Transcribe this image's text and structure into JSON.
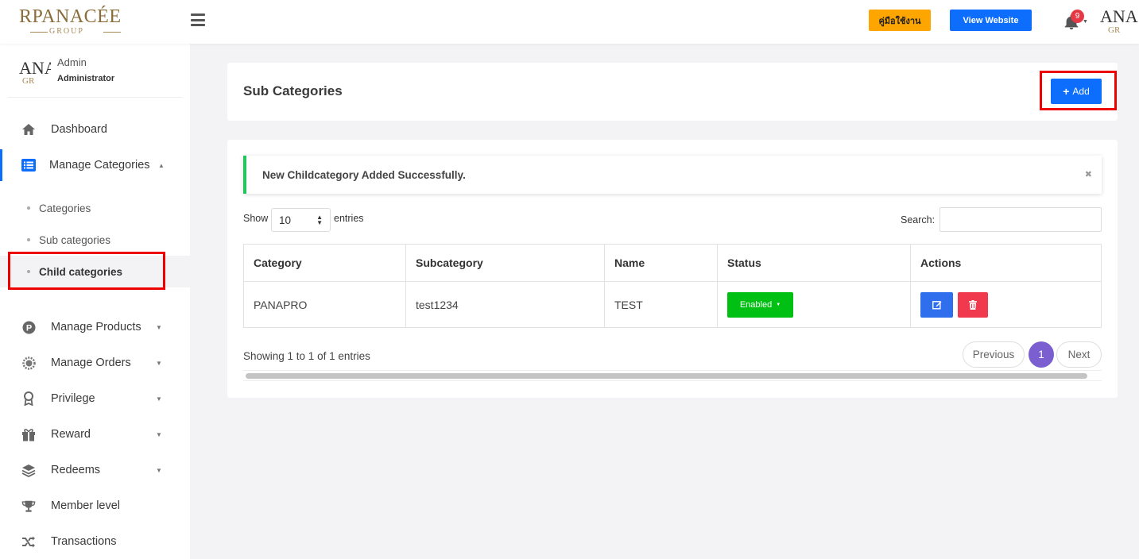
{
  "topbar": {
    "logo_main": "RPANACÉE",
    "logo_sub": "GROUP",
    "manual_label": "คู่มือใช้งาน",
    "view_website_label": "View Website",
    "notification_count": "9",
    "avatar_main": "ANA",
    "avatar_sub": "GR"
  },
  "sidebar": {
    "user": {
      "name": "Admin",
      "role": "Administrator",
      "avatar_main": "ANA",
      "avatar_sub": "GR"
    },
    "items": [
      {
        "label": "Dashboard",
        "icon": "home-icon"
      },
      {
        "label": "Manage Categories",
        "icon": "list-icon",
        "expanded": true
      },
      {
        "label": "Manage Products",
        "icon": "p-circle-icon"
      },
      {
        "label": "Manage Orders",
        "icon": "gear-badge-icon"
      },
      {
        "label": "Privilege",
        "icon": "award-icon"
      },
      {
        "label": "Reward",
        "icon": "gift-icon"
      },
      {
        "label": "Redeems",
        "icon": "layers-icon"
      },
      {
        "label": "Member level",
        "icon": "trophy-icon"
      },
      {
        "label": "Transactions",
        "icon": "shuffle-icon"
      }
    ],
    "sub_items": [
      {
        "label": "Categories"
      },
      {
        "label": "Sub categories"
      },
      {
        "label": "Child categories",
        "current": true
      }
    ]
  },
  "page": {
    "title": "Sub Categories",
    "add_label": "Add",
    "alert": "New Childcategory Added Successfully.",
    "alert_close": "✖",
    "show_label": "Show",
    "entries_value": "10",
    "entries_label": "entries",
    "search_label": "Search:",
    "search_value": ""
  },
  "table": {
    "headers": [
      "Category",
      "Subcategory",
      "Name",
      "Status",
      "Actions"
    ],
    "rows": [
      {
        "category": "PANAPRO",
        "subcategory": "test1234",
        "name": "TEST",
        "status": "Enabled"
      }
    ]
  },
  "pagination": {
    "info": "Showing 1 to 1 of 1 entries",
    "previous": "Previous",
    "current": "1",
    "next": "Next"
  },
  "colors": {
    "primary": "#0d6efd",
    "manual_button": "#ffa500",
    "status_enabled": "#00c013",
    "delete": "#f0394d",
    "pagination_active": "#7b5fd1",
    "highlight": "#ee0000",
    "alert_border": "#22c55e"
  }
}
